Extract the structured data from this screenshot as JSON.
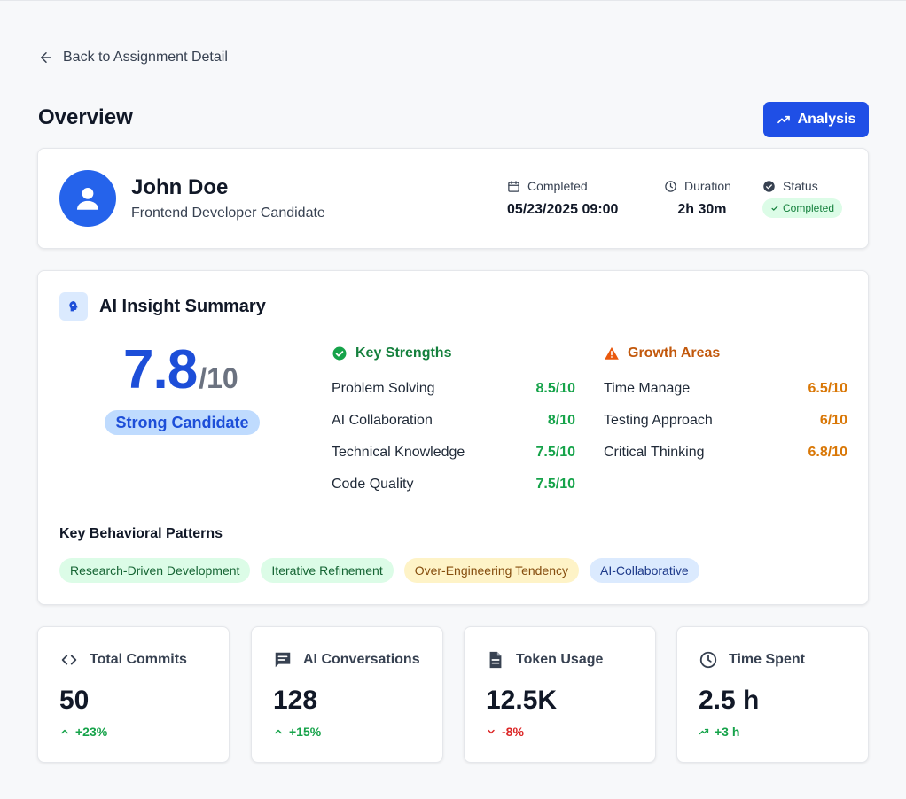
{
  "nav": {
    "back_label": "Back to Assignment Detail"
  },
  "header": {
    "title": "Overview",
    "analysis_label": "Analysis"
  },
  "candidate": {
    "name": "John Doe",
    "role": "Frontend Developer Candidate",
    "completed_label": "Completed",
    "completed_value": "05/23/2025 09:00",
    "duration_label": "Duration",
    "duration_value": "2h 30m",
    "status_label": "Status",
    "status_value": "Completed"
  },
  "insight": {
    "title": "AI Insight Summary",
    "score": "7.8",
    "score_max": "/10",
    "verdict": "Strong Candidate",
    "strengths_title": "Key Strengths",
    "strengths": [
      {
        "label": "Problem Solving",
        "value": "8.5/10"
      },
      {
        "label": "AI Collaboration",
        "value": "8/10"
      },
      {
        "label": "Technical Knowledge",
        "value": "7.5/10"
      },
      {
        "label": "Code Quality",
        "value": "7.5/10"
      }
    ],
    "growth_title": "Growth Areas",
    "growth": [
      {
        "label": "Time Manage",
        "value": "6.5/10"
      },
      {
        "label": "Testing Approach",
        "value": "6/10"
      },
      {
        "label": "Critical Thinking",
        "value": "6.8/10"
      }
    ],
    "patterns_title": "Key Behavioral Patterns",
    "patterns": [
      "Research-Driven Development",
      "Iterative Refinement",
      "Over-Engineering Tendency",
      "AI-Collaborative"
    ]
  },
  "stats": [
    {
      "label": "Total Commits",
      "value": "50",
      "delta": "+23%",
      "icon": "code-icon"
    },
    {
      "label": "AI Conversations",
      "value": "128",
      "delta": "+15%",
      "icon": "chat-icon"
    },
    {
      "label": "Token Usage",
      "value": "12.5K",
      "delta": "-8%",
      "icon": "document-icon"
    },
    {
      "label": "Time Spent",
      "value": "2.5 h",
      "delta": "+3 h",
      "icon": "clock-icon"
    }
  ],
  "colors": {
    "accent": "#1f4fe6",
    "success": "#16a34a",
    "warning": "#d97706",
    "danger": "#dc2626"
  }
}
